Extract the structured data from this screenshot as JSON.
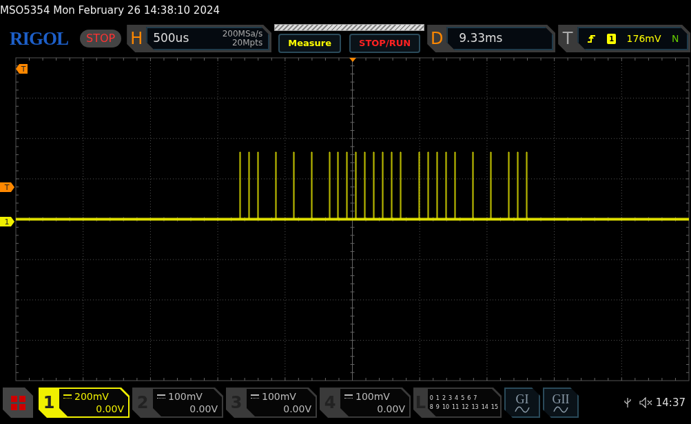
{
  "status_line": "MSO5354  Mon February 26 14:38:10 2024",
  "logo": "RIGOL",
  "run_state": {
    "label": "STOP",
    "running": false
  },
  "horizontal": {
    "label": "H",
    "timebase": "500us",
    "sample_rate": "200MSa/s",
    "memory_depth": "20Mpts"
  },
  "buttons": [
    "Measure",
    "STOP/RUN"
  ],
  "delay": {
    "label": "D",
    "value": "9.33ms"
  },
  "trigger": {
    "label": "T",
    "source": "1",
    "level": "176mV",
    "mode": "N"
  },
  "plot_markers": [
    {
      "kind": "trigger-position",
      "text": "T"
    },
    {
      "kind": "trigger-level",
      "text": "T"
    },
    {
      "kind": "channel",
      "text": "1"
    }
  ],
  "channels": [
    {
      "number": "1",
      "scale": "200mV",
      "offset": "0.00V",
      "selected": true
    },
    {
      "number": "2",
      "scale": "100mV",
      "offset": "0.00V",
      "selected": false
    },
    {
      "number": "3",
      "scale": "100mV",
      "offset": "0.00V",
      "selected": false
    },
    {
      "number": "4",
      "scale": "100mV",
      "offset": "0.00V",
      "selected": false
    }
  ],
  "logic": {
    "label": "L",
    "bits_row_1": [
      "0",
      "1",
      "2",
      "3",
      "4",
      "5",
      "6",
      "7"
    ],
    "bits_row_2": [
      "8",
      "9",
      "10",
      "11",
      "12",
      "13",
      "14",
      "15"
    ]
  },
  "generators": [
    "GI",
    "GII"
  ],
  "clock": "14:37"
}
